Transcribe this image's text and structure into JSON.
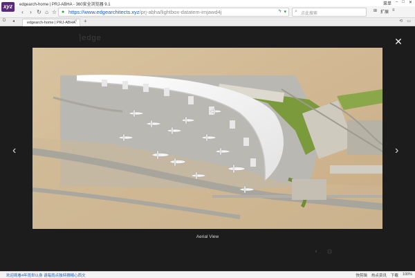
{
  "window": {
    "title": "edgearch-home | PRJ-ABHA - 360安全浏览器 9.1",
    "controls": [
      "菜单",
      "–",
      "□",
      "✕"
    ]
  },
  "toolbar": {
    "url_main": "https://www.edgearchitects.xyz",
    "url_rest": "/prj-abha/lightbox-datatem-imjawd4j",
    "search_placeholder": "点此搜索",
    "extensions_label": "扩展",
    "grid_icon_label": "⊞"
  },
  "tabs": {
    "active_label": "edgearch-home | PRJ-ABHA",
    "left_label": "D"
  },
  "page": {
    "site_logo": "⌉edge",
    "close_label": "✕",
    "prev_label": "‹",
    "next_label": "›",
    "caption": "Aerial View"
  },
  "status": {
    "left_text": "欢迎观看4年雨世以身 请每雨点独特猜精心西文",
    "right_items": [
      "快剪辑",
      "热点资讯",
      "下载",
      "100%"
    ]
  },
  "colors": {
    "page_bg": "#1c1c1c",
    "accent_url": "#1a5fb4",
    "secure_green": "#2a9a3a",
    "logo_purple": "#5a2a7a"
  }
}
